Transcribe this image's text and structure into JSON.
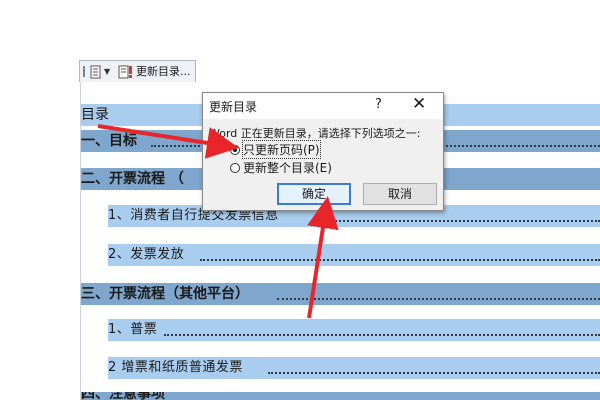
{
  "toolbar": {
    "update_label": "更新目录...",
    "icons": [
      "document-icon",
      "dropdown-icon",
      "update-toc-icon"
    ]
  },
  "toc": {
    "heading": "目录",
    "rows": [
      {
        "text": "一、目标",
        "level": 1
      },
      {
        "text": "二、开票流程 （",
        "level": 1
      },
      {
        "text": "1、消费者自行提交发票信息",
        "level": 2
      },
      {
        "text": "2、发票发放",
        "level": 2
      },
      {
        "text": "三、开票流程（其他平台）",
        "level": 1
      },
      {
        "text": "1、普票",
        "level": 2
      },
      {
        "text": "2 增票和纸质普通发票",
        "level": 2
      },
      {
        "text": "四、注意事项",
        "level": 1
      }
    ]
  },
  "dialog": {
    "title": "更新目录",
    "help": "?",
    "close": "✕",
    "prompt": "Word 正在更新目录，请选择下列选项之一:",
    "option_page_numbers": "只更新页码(P)",
    "option_entire": "更新整个目录(E)",
    "selected_option": "只更新页码(P)",
    "ok": "确定",
    "cancel": "取消"
  },
  "colors": {
    "highlight_dark": "#7fa6cc",
    "highlight_light": "#a9cdee",
    "arrow": "#e8262a",
    "ok_focus": "#3b7bd6"
  }
}
